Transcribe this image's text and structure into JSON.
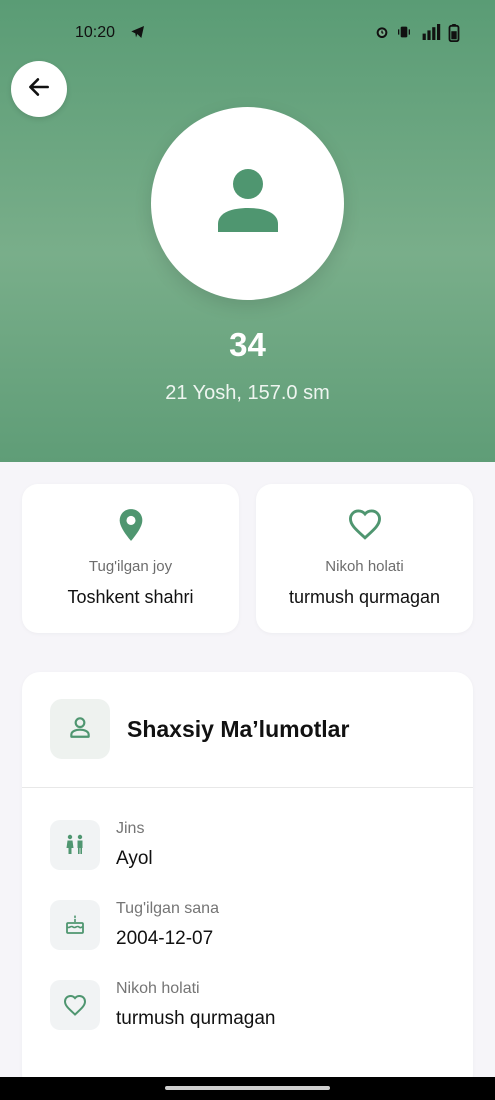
{
  "status_bar": {
    "time": "10:20"
  },
  "profile": {
    "name": "34",
    "subtitle": "21 Yosh, 157.0 sm"
  },
  "cards": [
    {
      "icon": "location-pin-icon",
      "label": "Tug'ilgan joy",
      "value": "Toshkent shahri"
    },
    {
      "icon": "heart-icon",
      "label": "Nikoh holati",
      "value": "turmush qurmagan"
    }
  ],
  "personal": {
    "title": "Shaxsiy Ma’lumotlar",
    "rows": [
      {
        "icon": "gender-icon",
        "label": "Jins",
        "value": "Ayol"
      },
      {
        "icon": "cake-icon",
        "label": "Tug'ilgan sana",
        "value": "2004-12-07"
      },
      {
        "icon": "heart-icon",
        "label": "Nikoh holati",
        "value": "turmush qurmagan"
      }
    ]
  },
  "colors": {
    "accent": "#4f9670",
    "header_top": "#5a9c75",
    "header_mid": "#79ae8a",
    "background": "#f6f5f9"
  }
}
